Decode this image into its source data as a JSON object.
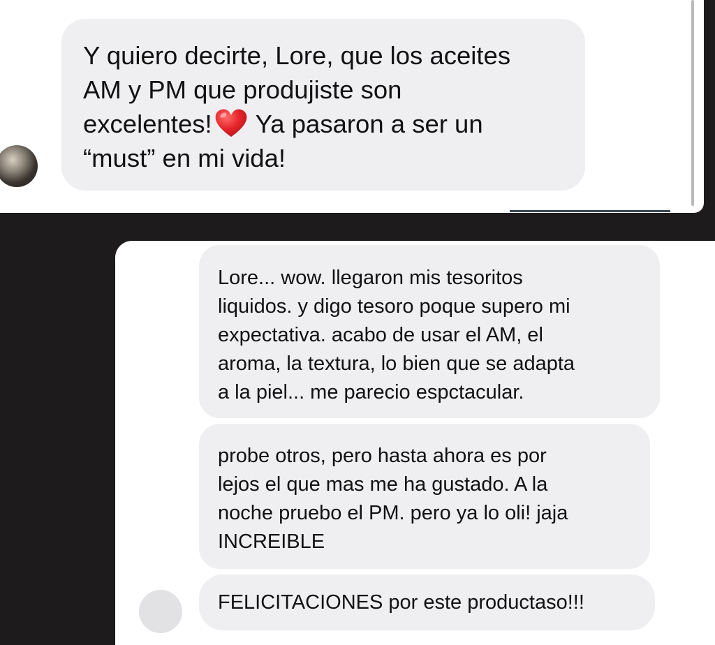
{
  "messages": {
    "incoming_top": {
      "line1": "Y quiero decirte, Lore, que los aceites",
      "line2": "AM y PM que produjiste son",
      "line3_before_emoji": "excelentes!",
      "emoji": "heart-emoji",
      "line3_after_emoji": "Ya pasaron a ser un",
      "line4": "“must” en mi vida!"
    },
    "incoming_bottom": [
      {
        "lines": [
          "Lore... wow. llegaron mis tesoritos",
          "liquidos. y digo tesoro poque supero mi",
          "expectativa. acabo de usar el AM, el",
          "aroma, la textura, lo bien que se adapta",
          "a la piel... me parecio espctacular."
        ]
      },
      {
        "lines": [
          "probe otros, pero hasta ahora es por",
          "lejos el que mas me ha gustado. A la",
          "noche pruebo el PM. pero ya lo oli! jaja",
          "INCREIBLE"
        ]
      },
      {
        "lines": [
          "FELICITACIONES por este productaso!!!"
        ]
      }
    ]
  },
  "colors": {
    "background": "#1d1b1c",
    "panel": "#ffffff",
    "bubble": "#efeff2",
    "text": "#111111",
    "heart": "#e5252a"
  }
}
